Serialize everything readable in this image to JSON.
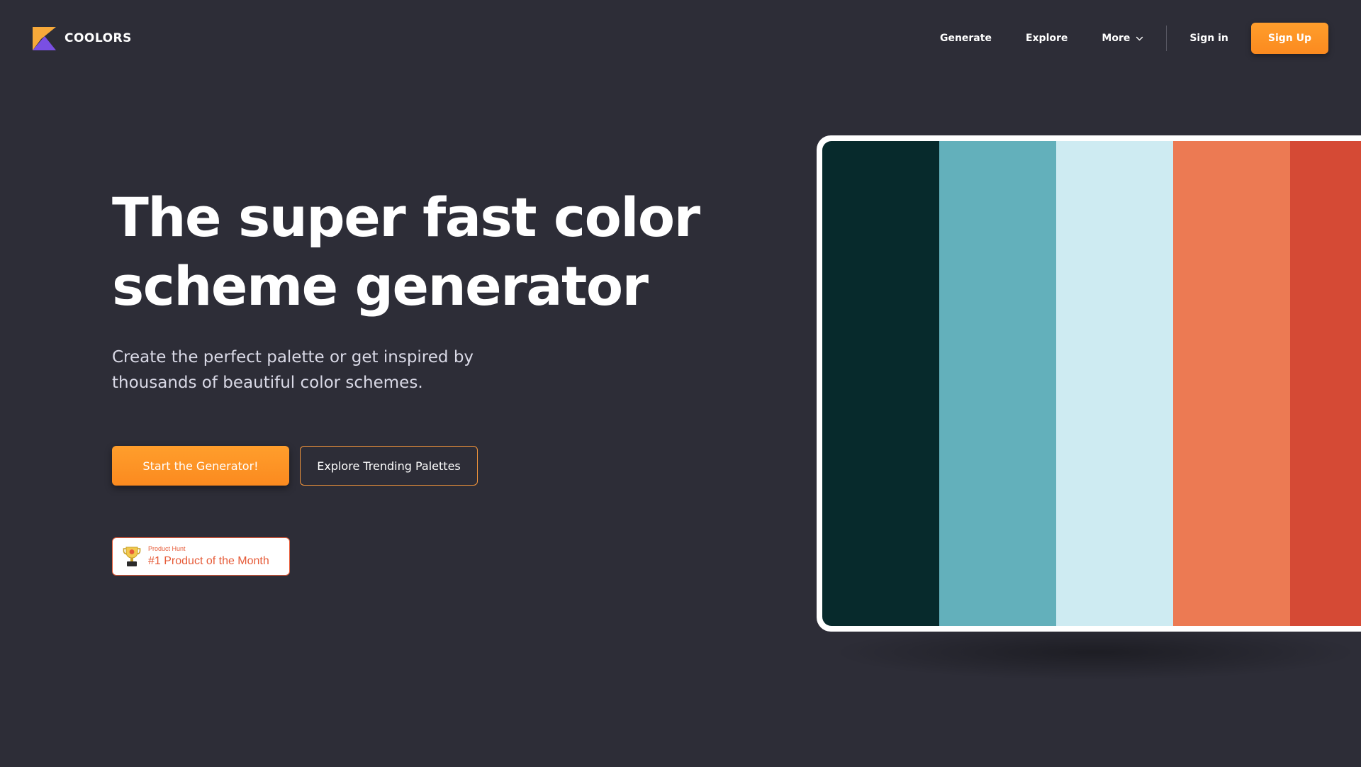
{
  "header": {
    "logo_text": "COOLORS",
    "logo_icon": "coolors-logo-icon",
    "nav": {
      "generate": "Generate",
      "explore": "Explore",
      "more": "More",
      "sign_in": "Sign in",
      "sign_up": "Sign Up"
    }
  },
  "hero": {
    "title_line1": "The super fast color",
    "title_line2": "scheme generator",
    "subtitle_line1": "Create the perfect palette or get inspired by",
    "subtitle_line2": "thousands of beautiful color schemes.",
    "primary_button": "Start the Generator!",
    "secondary_button": "Explore Trending Palettes"
  },
  "badge": {
    "small_text": "Product Hunt",
    "main_text": "#1 Product of the Month",
    "icon": "trophy-icon"
  },
  "palette": {
    "colors": [
      "#072a2c",
      "#63b0bb",
      "#ceebf2",
      "#ec7a53",
      "#d54a35"
    ]
  },
  "theme": {
    "background": "#2d2d37",
    "accent": "#fb8a1f",
    "badge_accent": "#e65b38"
  }
}
